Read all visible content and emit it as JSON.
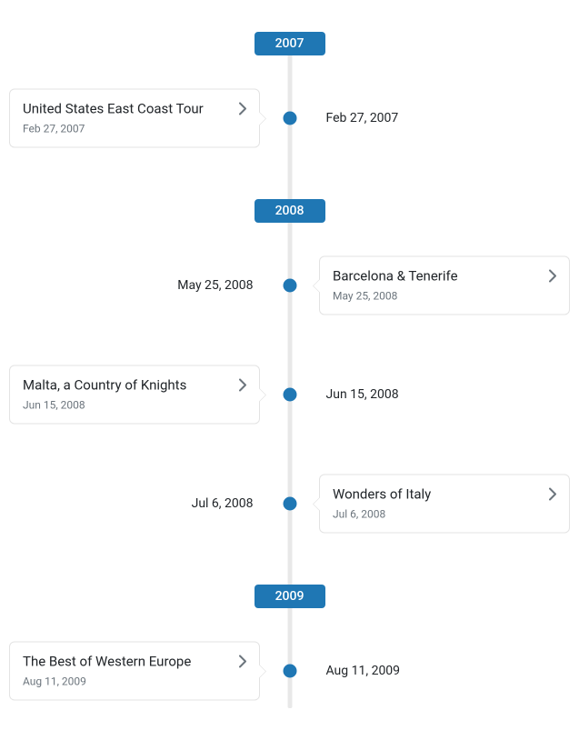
{
  "years": {
    "y2007": "2007",
    "y2008": "2008",
    "y2009": "2009"
  },
  "entries": [
    {
      "title": "United States East Coast Tour",
      "card_date": "Feb 27, 2007",
      "opposite_date": "Feb 27, 2007",
      "side": "left"
    },
    {
      "title": "Barcelona & Tenerife",
      "card_date": "May 25, 2008",
      "opposite_date": "May 25, 2008",
      "side": "right"
    },
    {
      "title": "Malta, a Country of Knights",
      "card_date": "Jun 15, 2008",
      "opposite_date": "Jun 15, 2008",
      "side": "left"
    },
    {
      "title": "Wonders of Italy",
      "card_date": "Jul 6, 2008",
      "opposite_date": "Jul 6, 2008",
      "side": "right"
    },
    {
      "title": "The Best of Western Europe",
      "card_date": "Aug 11, 2009",
      "opposite_date": "Aug 11, 2009",
      "side": "left"
    }
  ]
}
